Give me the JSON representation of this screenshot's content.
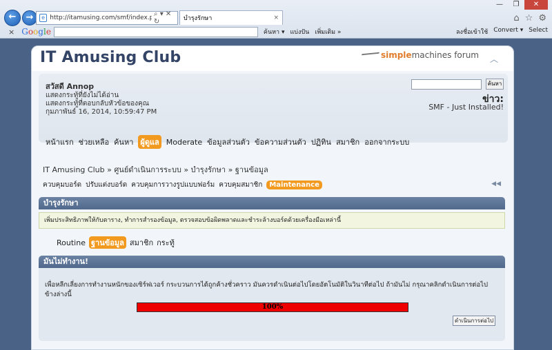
{
  "browser": {
    "url": "http://itamusing.com/smf/index.php?action",
    "tab_title": "บำรุงรักษา",
    "tab_close": "×",
    "back": "←",
    "forward": "→",
    "addr_controls": "⌕ ▾ ✕ ↻",
    "window_controls": [
      "—",
      "❐",
      "✕"
    ],
    "tool_icons": [
      "⌂",
      "☆",
      "⚙"
    ],
    "toolbar": {
      "close": "×",
      "google": [
        "G",
        "o",
        "o",
        "g",
        "l",
        "e"
      ],
      "search_label": "ค้นหา ▾",
      "share_label": "แบ่งปัน",
      "more_label": "เพิ่มเติม »",
      "signin_label": "ลงชื่อเข้าใช้",
      "convert_label": "Convert ▾",
      "select_label": "Select"
    }
  },
  "header": {
    "title": "IT Amusing Club",
    "logo_simple": "simple",
    "logo_rest": "machines forum",
    "collapse": "︿"
  },
  "user": {
    "greeting": "สวัสดี Annop",
    "unread": "แสดงกระทู้ที่ยังไม่ได้อ่าน",
    "replies": "แสดงกระทู้ที่ตอบกลับหัวข้อของคุณ",
    "datetime": "กุมภาพันธ์ 16, 2014, 10:59:47 PM",
    "search_button": "ค้นหา",
    "news_label": "ข่าว:",
    "news_text": "SMF - Just Installed!"
  },
  "mainmenu": [
    "หน้าแรก",
    "ช่วยเหลือ",
    "ค้นหา",
    "ผู้ดูแล",
    "Moderate",
    "ข้อมูลส่วนตัว",
    "ข้อความส่วนตัว",
    "ปฏิทิน",
    "สมาชิก",
    "ออกจากระบบ"
  ],
  "linktree": "IT Amusing Club » ศูนย์ดำเนินการระบบ » บำรุงรักษา » ฐานข้อมูล",
  "admin_tabs": [
    "ควบคุมบอร์ด",
    "ปรับแต่งบอร์ด",
    "ควบคุมการวางรูปแบบฟอร์ม",
    "ควบคุมสมาชิก",
    "Maintenance"
  ],
  "admin_toggle": "◀◀",
  "maintenance": {
    "title": "บำรุงรักษา",
    "info": "เพิ่มประสิทธิภาพให้กับตาราง, ทำการสำรองข้อมูล, ตรวจสอบข้อผิดพลาดและชำระล้างบอร์ดด้วยเครื่องมือเหล่านี้",
    "subtabs": [
      "Routine",
      "ฐานข้อมูล",
      "สมาชิก",
      "กระทู้"
    ]
  },
  "not_done": {
    "title": "มันไม่ทำงาน!",
    "text": "เพื่อหลีกเลี่ยงการทำงานหนักของเซิร์ฟเวอร์ กระบวนการได้ถูกค้างชั่วคราว มันควรดำเนินต่อไปโดยอัตโนมัติในวินาทีต่อไป ถ้ามันไม่ กรุณาคลิกดำเนินการต่อไปข้างล่างนี้",
    "progress_label": "100%",
    "progress_value": 100,
    "continue_button": "ดำเนินการต่อไป"
  },
  "colors": {
    "accent": "#f29a1f",
    "catbar": "#5b7396",
    "progress": "#ee0000"
  }
}
